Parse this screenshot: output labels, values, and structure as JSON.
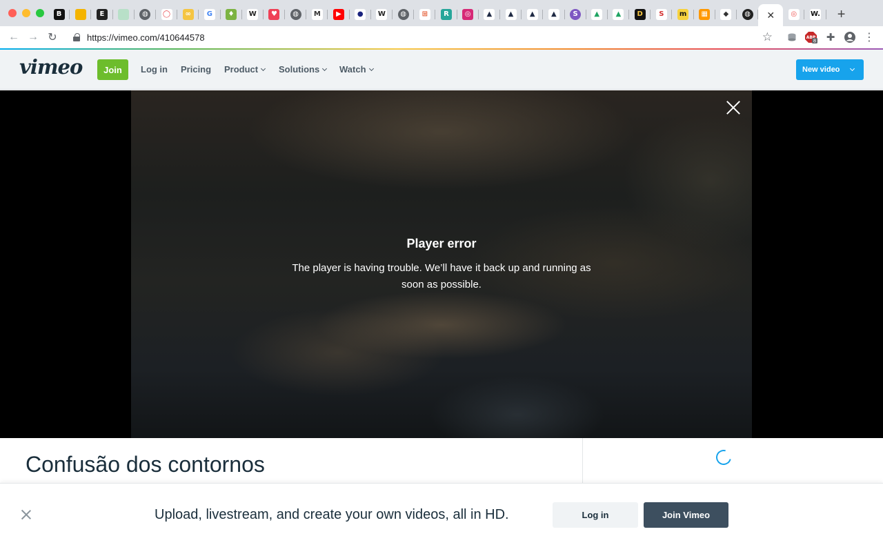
{
  "browser": {
    "url": "https://vimeo.com/410644578",
    "tabs": [
      {
        "icon": "b-square-icon",
        "glyph": "B",
        "bg": "#111111",
        "fg": "#ffffff"
      },
      {
        "icon": "slides-icon",
        "glyph": "",
        "bg": "#f4b400",
        "fg": "#ffffff"
      },
      {
        "icon": "e-square-icon",
        "glyph": "E",
        "bg": "#222222",
        "fg": "#ffffff"
      },
      {
        "icon": "sheet-icon",
        "glyph": "",
        "bg": "#b8e0c8",
        "fg": "#ffffff"
      },
      {
        "icon": "globe-icon",
        "glyph": "◍",
        "bg": "#5f6368",
        "fg": "#ffffff",
        "round": true
      },
      {
        "icon": "drop-icon",
        "glyph": "◯",
        "bg": "#ffffff",
        "fg": "#e8434a"
      },
      {
        "icon": "link-icon",
        "glyph": "∞",
        "bg": "#f5c542",
        "fg": "#ffffff"
      },
      {
        "icon": "google-icon",
        "glyph": "G",
        "bg": "#ffffff",
        "fg": "#4285f4"
      },
      {
        "icon": "shield-green-icon",
        "glyph": "♦",
        "bg": "#7cb342",
        "fg": "#ffffff"
      },
      {
        "icon": "wikipedia-icon",
        "glyph": "W",
        "bg": "#ffffff",
        "fg": "#222222"
      },
      {
        "icon": "pocket-icon",
        "glyph": "♥",
        "bg": "#ef4056",
        "fg": "#ffffff"
      },
      {
        "icon": "globe-icon",
        "glyph": "◍",
        "bg": "#5f6368",
        "fg": "#ffffff",
        "round": true
      },
      {
        "icon": "medium-icon",
        "glyph": "M",
        "bg": "#ffffff",
        "fg": "#333333"
      },
      {
        "icon": "youtube-icon",
        "glyph": "▶",
        "bg": "#ff0000",
        "fg": "#ffffff"
      },
      {
        "icon": "circle-dark-icon",
        "glyph": "●",
        "bg": "#ffffff",
        "fg": "#1a237e"
      },
      {
        "icon": "wikipedia-icon",
        "glyph": "W",
        "bg": "#ffffff",
        "fg": "#222222"
      },
      {
        "icon": "globe-icon",
        "glyph": "◍",
        "bg": "#5f6368",
        "fg": "#ffffff",
        "round": true
      },
      {
        "icon": "grid-icon",
        "glyph": "⊞",
        "bg": "#ffffff",
        "fg": "#e4572e"
      },
      {
        "icon": "r-square-icon",
        "glyph": "R",
        "bg": "#26a69a",
        "fg": "#ffffff"
      },
      {
        "icon": "instagram-icon",
        "glyph": "◎",
        "bg": "#d62976",
        "fg": "#ffffff"
      },
      {
        "icon": "arc-icon",
        "glyph": "▲",
        "bg": "#ffffff",
        "fg": "#1f2a44"
      },
      {
        "icon": "arc-icon",
        "glyph": "▲",
        "bg": "#ffffff",
        "fg": "#1f2a44"
      },
      {
        "icon": "arc-icon",
        "glyph": "▲",
        "bg": "#ffffff",
        "fg": "#1f2a44"
      },
      {
        "icon": "arc-icon",
        "glyph": "▲",
        "bg": "#ffffff",
        "fg": "#1f2a44"
      },
      {
        "icon": "s-circle-icon",
        "glyph": "S",
        "bg": "#7e57c2",
        "fg": "#ffffff",
        "round": true
      },
      {
        "icon": "drive-icon",
        "glyph": "▲",
        "bg": "#ffffff",
        "fg": "#1fa463"
      },
      {
        "icon": "drive-icon",
        "glyph": "▲",
        "bg": "#ffffff",
        "fg": "#1fa463"
      },
      {
        "icon": "d-square-icon",
        "glyph": "D",
        "bg": "#111111",
        "fg": "#f5c542"
      },
      {
        "icon": "s-square-icon",
        "glyph": "S",
        "bg": "#ffffff",
        "fg": "#d32f2f"
      },
      {
        "icon": "m-yellow-icon",
        "glyph": "m",
        "bg": "#f7d23e",
        "fg": "#111111"
      },
      {
        "icon": "blocks-icon",
        "glyph": "▦",
        "bg": "#ff9800",
        "fg": "#ffffff"
      },
      {
        "icon": "diamond-icon",
        "glyph": "◆",
        "bg": "#ffffff",
        "fg": "#333333"
      },
      {
        "icon": "globe-dark-icon",
        "glyph": "◍",
        "bg": "#222222",
        "fg": "#ffffff",
        "round": true
      }
    ],
    "active_tab": {
      "icon": "close-icon",
      "glyph": "✕"
    },
    "trailing_tabs": [
      {
        "icon": "target-icon",
        "glyph": "◎",
        "bg": "#ffffff",
        "fg": "#ef5350"
      },
      {
        "icon": "w-dot-icon",
        "glyph": "W.",
        "bg": "#ffffff",
        "fg": "#111111"
      }
    ],
    "new_tab_glyph": "+",
    "abp_badge": "8"
  },
  "header": {
    "logo": "vimeo",
    "join": "Join",
    "nav": {
      "login": "Log in",
      "pricing": "Pricing",
      "product": "Product",
      "solutions": "Solutions",
      "watch": "Watch"
    },
    "new_video": "New video"
  },
  "player": {
    "error_title": "Player error",
    "error_message": "The player is having trouble. We’ll have it back up and running as soon as possible."
  },
  "video": {
    "title": "Confusão dos contornos"
  },
  "banner": {
    "text": "Upload, livestream, and create your own videos, all in HD.",
    "login": "Log in",
    "join": "Join Vimeo"
  },
  "colors": {
    "join_green": "#6dbd2c",
    "new_video_blue": "#17a3ec",
    "join_vimeo_dark": "#3d4f5f",
    "brand_text": "#1a2e3b"
  }
}
